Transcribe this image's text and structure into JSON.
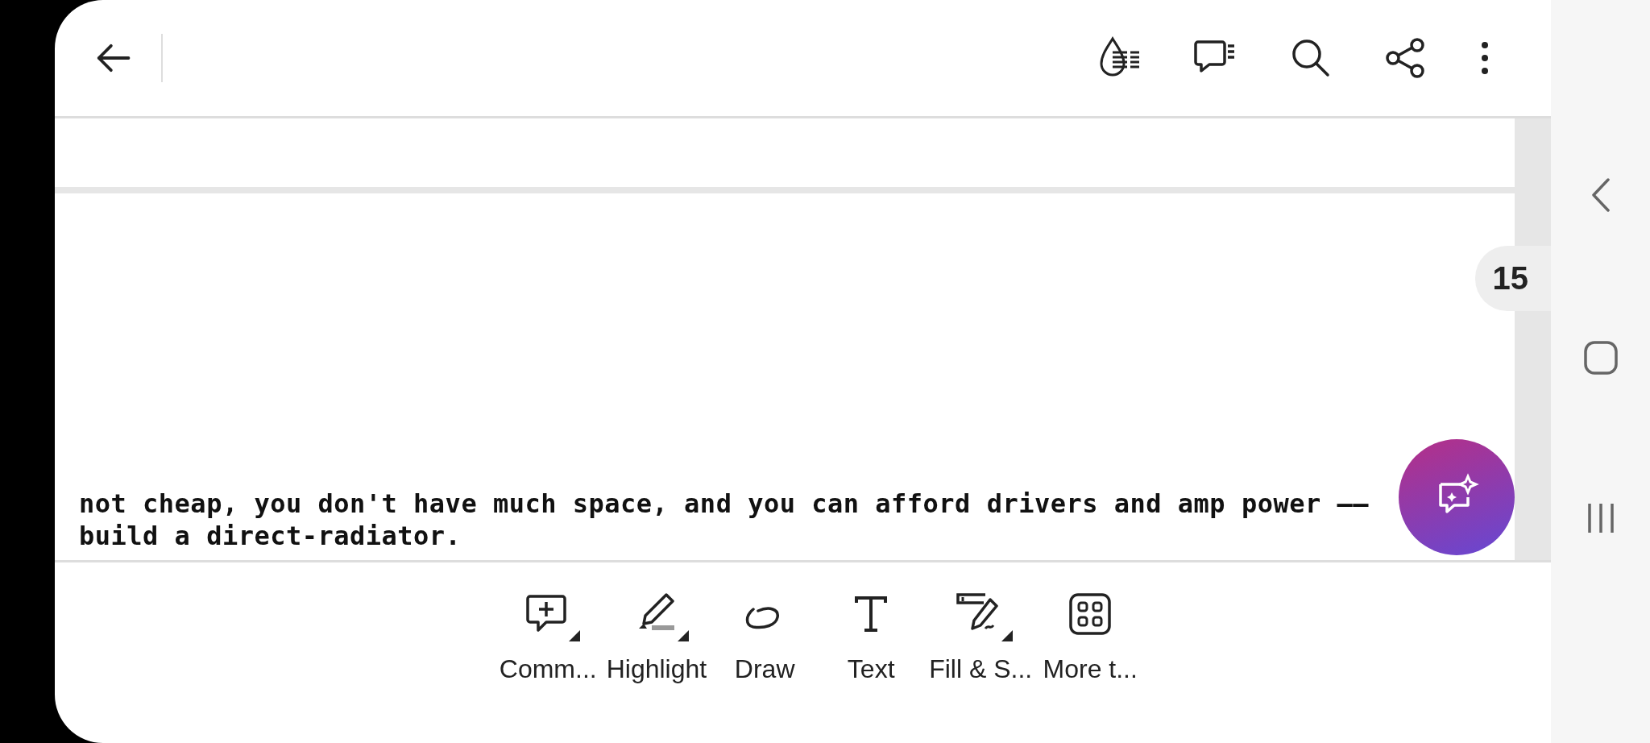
{
  "page_number": "15",
  "document_lines": [
    "not cheap, you don't have much space, and you can afford drivers and amp power —— ",
    "build a direct-radiator."
  ],
  "toolbar": [
    {
      "kind": "comment",
      "label": "Comm...",
      "dropdown": true
    },
    {
      "kind": "highlight",
      "label": "Highlight",
      "dropdown": true
    },
    {
      "kind": "draw",
      "label": "Draw",
      "dropdown": false
    },
    {
      "kind": "text",
      "label": "Text",
      "dropdown": false
    },
    {
      "kind": "fill",
      "label": "Fill & S...",
      "dropdown": true
    },
    {
      "kind": "more",
      "label": "More t...",
      "dropdown": false
    }
  ]
}
